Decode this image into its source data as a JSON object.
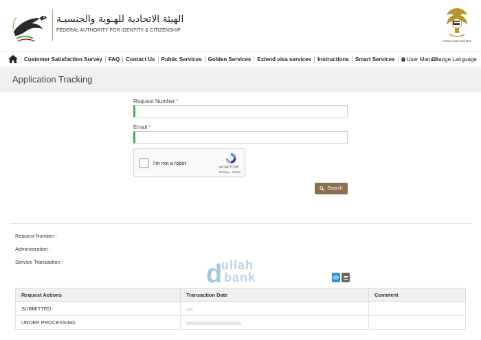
{
  "header": {
    "arabic_name": "الهيئة الاتحادية للهـوية والجنسيـة",
    "english_name": "FEDERAL AUTHORITY FOR IDENTITY & CITIZENSHIP",
    "emblem_caption": "United Arab Emirates"
  },
  "nav": {
    "items": [
      "Customer Satisfaction Survey",
      "FAQ",
      "Contact Us",
      "Public Services",
      "Golden Services",
      "Extend visa services",
      "Instructions",
      "Smart Services"
    ],
    "user_manual": "User Manual",
    "change_language": "Change Language"
  },
  "page": {
    "title": "Application Tracking"
  },
  "form": {
    "request_number_label": "Request Number",
    "email_label": "Email",
    "required_mark": "*",
    "request_number_value": "",
    "email_value": "",
    "captcha": {
      "label": "I'm not a robot",
      "brand": "reCAPTCHA",
      "links": "Privacy - Terms"
    },
    "search_label": "Search"
  },
  "result": {
    "request_number_label": "Request Number :",
    "administration_label": "Administration :",
    "service_transaction_label": "Service Transaction :"
  },
  "watermark": {
    "letter": "d",
    "top": "ullah",
    "bottom": "bank"
  },
  "table": {
    "headers": [
      "Request Actions",
      "Transaction Date",
      "Comment"
    ],
    "rows": [
      {
        "action": "SUBMITTED",
        "date": "",
        "comment": ""
      },
      {
        "action": "UNDER PROCESSING",
        "date": "",
        "comment": ""
      }
    ]
  },
  "colors": {
    "accent_green": "#3cb04b",
    "search_button": "#8b6f4e",
    "title_bar": "#eef0f2",
    "required": "#d9534f"
  }
}
